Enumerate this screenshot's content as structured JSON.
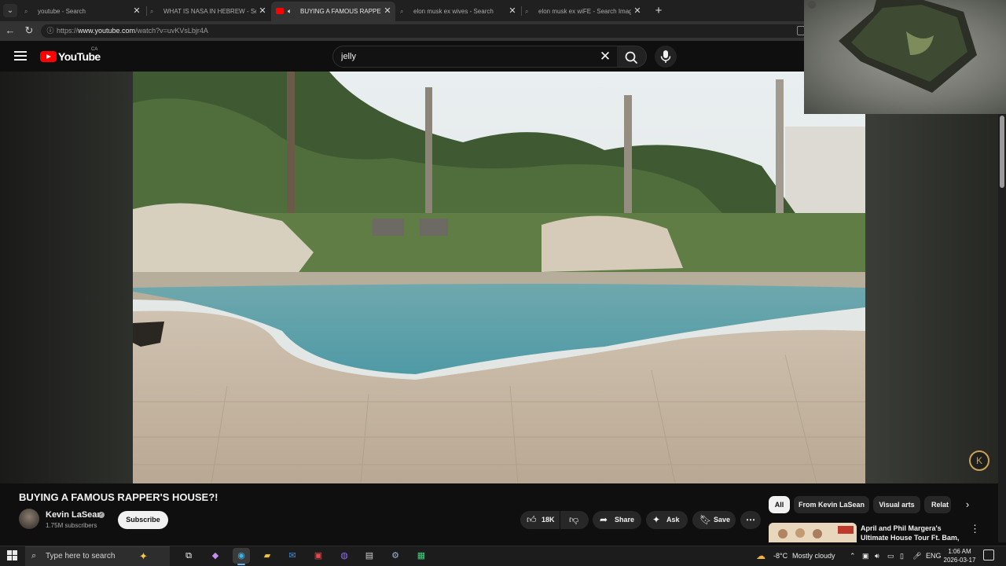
{
  "browser": {
    "tabs": [
      {
        "title": "youtube - Search",
        "icon": "search-icon"
      },
      {
        "title": "WHAT IS NASA IN HEBREW - Search",
        "icon": "search-icon"
      },
      {
        "title": "BUYING A FAMOUS RAPPER'S HOUSE?!",
        "icon": "youtube-icon",
        "audio": true,
        "active": true
      },
      {
        "title": "elon musk ex wives - Search",
        "icon": "search-icon"
      },
      {
        "title": "elon musk ex wiFE - Search Images",
        "icon": "search-icon"
      }
    ],
    "url_prefix": "https://",
    "url_domain": "www.youtube.com",
    "url_rest": "/watch?v=uvKVsLbjr4A"
  },
  "youtube": {
    "logo_text": "YouTube",
    "country_code": "CA",
    "search_value": "jelly",
    "accent_color": "#ff0000"
  },
  "video": {
    "title": "BUYING A FAMOUS RAPPER'S HOUSE?!",
    "channel": "Kevin LaSean",
    "subscribers": "1.75M subscribers",
    "subscribe_label": "Subscribe",
    "likes": "18K",
    "share_label": "Share",
    "ask_label": "Ask",
    "save_label": "Save",
    "overlay_letter": "K"
  },
  "chips": [
    "All",
    "From Kevin LaSean",
    "Visual arts",
    "Relat"
  ],
  "recommendation": {
    "title": "April and Phil Margera's Ultimate House Tour Ft. Bam, ..."
  },
  "taskbar": {
    "search_placeholder": "Type here to search",
    "weather": "-8°C",
    "weather_desc": "Mostly cloudy",
    "language": "ENG",
    "time": "1:06 AM",
    "date": "2026-03-17"
  }
}
